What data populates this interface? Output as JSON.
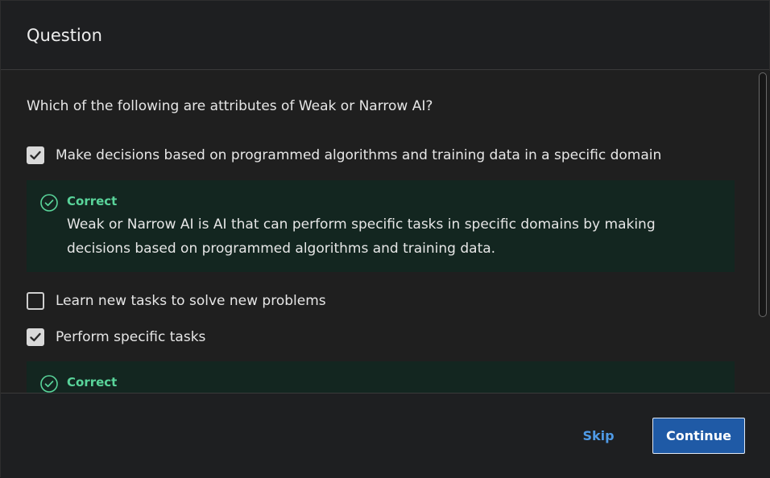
{
  "dialog": {
    "title": "Question"
  },
  "question": {
    "text": "Which of the following are attributes of Weak or Narrow AI?"
  },
  "options": [
    {
      "label": "Make decisions based on programmed algorithms and training data in a specific domain",
      "checked": true
    },
    {
      "label": "Learn new tasks to solve new problems",
      "checked": false
    },
    {
      "label": "Perform specific tasks",
      "checked": true
    }
  ],
  "feedback": [
    {
      "status": "Correct",
      "explanation": "Weak or Narrow AI is AI that can perform specific tasks in specific domains by making decisions based on programmed algorithms and training data."
    },
    {
      "status": "Correct"
    }
  ],
  "footer": {
    "skip_label": "Skip",
    "continue_label": "Continue"
  },
  "colors": {
    "correct": "#59d49a",
    "feedback_bg": "#132620",
    "primary": "#1f5aa6",
    "link": "#4f9ae6"
  },
  "icons": {
    "check": "checkmark-icon",
    "correct": "check-circle-icon"
  }
}
